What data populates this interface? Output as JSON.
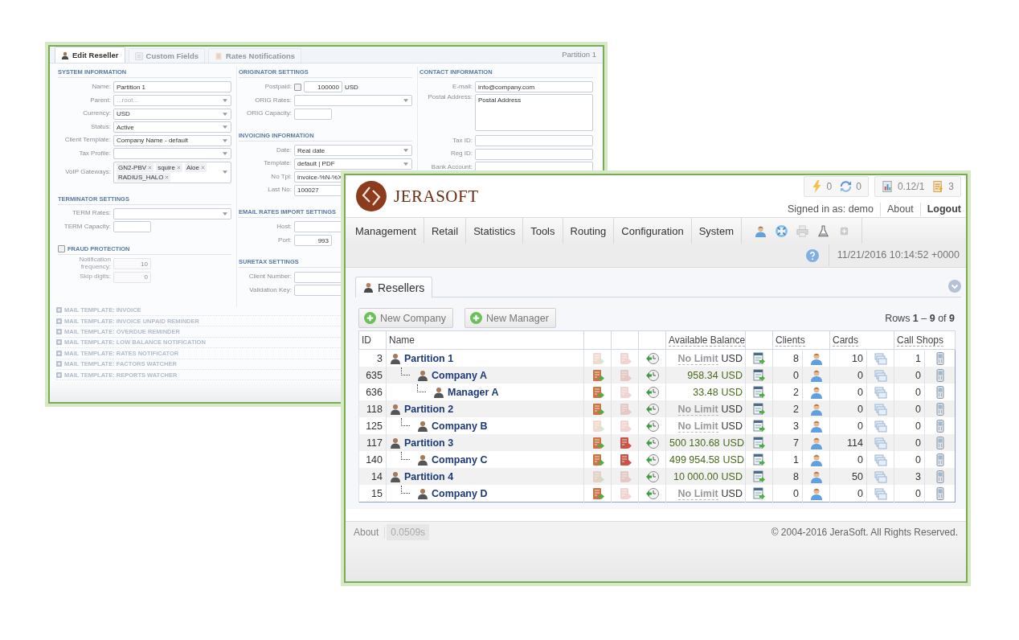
{
  "back_window": {
    "tabs": [
      {
        "label": "Edit Reseller",
        "selected": true
      },
      {
        "label": "Custom Fields",
        "selected": false
      },
      {
        "label": "Rates Notifications",
        "selected": false
      }
    ],
    "heading": "Partition 1",
    "columns": [
      [
        {
          "title": "SYSTEM INFORMATION",
          "kind": "plain",
          "fields": [
            {
              "label": "Name:",
              "kind": "text",
              "value": "Partition 1"
            },
            {
              "label": "Parent:",
              "kind": "select",
              "placeholder": "...root..."
            },
            {
              "label": "Currency:",
              "kind": "select",
              "value": "USD"
            },
            {
              "label": "Status:",
              "kind": "select",
              "value": "Active"
            },
            {
              "label": "Client Template:",
              "kind": "select",
              "value": "Company Name - default"
            },
            {
              "label": "Tax Profile:",
              "kind": "select"
            },
            {
              "label": "VoIP Gateways:",
              "kind": "tags",
              "tags": [
                "GN2-PBV",
                "squire",
                "Aloe",
                "RADIUS_HALO"
              ]
            }
          ]
        },
        {
          "title": "TERMINATOR SETTINGS",
          "kind": "plain",
          "fields": [
            {
              "label": "TERM Rates:",
              "kind": "select"
            },
            {
              "label": "TERM Capacity:",
              "kind": "short"
            }
          ]
        },
        {
          "title": "FRAUD PROTECTION",
          "kind": "toggle",
          "checked": false,
          "fields": [
            {
              "label": "Notification frequency:",
              "kind": "short",
              "value": "10",
              "disabled": true
            },
            {
              "label": "Skip digits:",
              "kind": "short",
              "value": "0",
              "disabled": true
            }
          ]
        }
      ],
      [
        {
          "title": "ORIGINATOR SETTINGS",
          "kind": "plain",
          "fields": [
            {
              "label": "Postpaid:",
              "kind": "amount",
              "checked": false,
              "value": "100000",
              "unit": "USD"
            },
            {
              "label": "ORIG Rates:",
              "kind": "select"
            },
            {
              "label": "ORIG Capacity:",
              "kind": "short"
            }
          ]
        },
        {
          "title": "INVOICING INFORMATION",
          "kind": "plain",
          "fields": [
            {
              "label": "Date:",
              "kind": "select",
              "value": "Real date"
            },
            {
              "label": "Template:",
              "kind": "select",
              "value": "default | PDF"
            },
            {
              "label": "No Tpl:",
              "kind": "text",
              "value": "invoice-%N-%X"
            },
            {
              "label": "Last No:",
              "kind": "text",
              "value": "100027"
            }
          ]
        },
        {
          "title": "EMAIL RATES IMPORT SETTINGS",
          "kind": "plain",
          "fields": [
            {
              "label": "Host:",
              "kind": "text"
            },
            {
              "label": "Port:",
              "kind": "short",
              "value": "993"
            }
          ]
        },
        {
          "title": "SURETAX SETTINGS",
          "kind": "plain",
          "fields": [
            {
              "label": "Client Number:",
              "kind": "text"
            },
            {
              "label": "Validation Key:",
              "kind": "text"
            }
          ]
        }
      ],
      [
        {
          "title": "CONTACT INFORMATION",
          "kind": "plain",
          "fields": [
            {
              "label": "E-mail:",
              "kind": "text",
              "value": "info@company.com"
            },
            {
              "label": "Postal Address:",
              "kind": "textarea",
              "value": "Postal Address"
            },
            {
              "label": "Tax ID:",
              "kind": "text"
            },
            {
              "label": "Reg ID:",
              "kind": "text"
            },
            {
              "label": "Bank Account:",
              "kind": "text"
            }
          ]
        }
      ]
    ],
    "mail_templates": [
      {
        "label": "MAIL TEMPLATE: INVOICE",
        "expanded": false
      },
      {
        "label": "MAIL TEMPLATE: INVOICE UNPAID REMINDER",
        "expanded": false
      },
      {
        "label": "MAIL TEMPLATE: OVERDUE REMINDER",
        "expanded": false
      },
      {
        "label": "MAIL TEMPLATE: LOW BALANCE NOTIFICATION",
        "expanded": false
      },
      {
        "label": "MAIL TEMPLATE: RATES NOTIFICATOR",
        "expanded": false
      },
      {
        "label": "MAIL TEMPLATE: FACTORS WATCHER",
        "expanded": false
      },
      {
        "label": "MAIL TEMPLATE: REPORTS WATCHER",
        "expanded": false
      }
    ]
  },
  "front_window": {
    "logo": "JERASOFT",
    "counter_groups": [
      [
        {
          "kind": "alerts",
          "value": "0"
        },
        {
          "kind": "sync",
          "value": "0"
        }
      ],
      [
        {
          "kind": "load",
          "value": "0.12/1"
        },
        {
          "kind": "tasks",
          "value": "3"
        }
      ]
    ],
    "signed_in": "Signed in as: demo",
    "about": "About",
    "logout": "Logout",
    "menu": [
      "Management",
      "Retail",
      "Statistics",
      "Tools",
      "Routing",
      "Configuration",
      "System"
    ],
    "toolbar_icons": [
      {
        "kind": "user",
        "disabled": false
      },
      {
        "kind": "lifebuoy",
        "disabled": false
      },
      {
        "kind": "printer",
        "disabled": true
      },
      {
        "kind": "flask",
        "disabled": false
      },
      {
        "kind": "add",
        "disabled": true
      }
    ],
    "datetime": "11/21/2016 10:14:52 +0000",
    "tabs": [
      {
        "label": "Resellers",
        "selected": true
      }
    ],
    "buttons": [
      "New Company",
      "New Manager"
    ],
    "rows_info": "Rows **1** – **9** of **9**",
    "table": {
      "columns": [
        "ID",
        "Name",
        "Available Balance",
        "Clients",
        "Cards",
        "Call Shops"
      ],
      "rows": [
        {
          "id": "3",
          "name": "Partition 1",
          "invoices_active": false,
          "charges_active": false,
          "balance": {
            "kind": "unlimited",
            "value": "No Limit"
          },
          "currency": "USD",
          "clients": "8",
          "cards": "10",
          "call_shops": "1",
          "children": [
            {
              "id": "635",
              "name": "Company A",
              "invoices_active": true,
              "charges_active": false,
              "balance": {
                "kind": "amount",
                "value": "958.34"
              },
              "currency": "USD",
              "clients": "0",
              "cards": "0",
              "call_shops": "0",
              "children": [
                {
                  "id": "636",
                  "name": "Manager A",
                  "invoices_active": true,
                  "charges_active": false,
                  "balance": {
                    "kind": "amount",
                    "value": "33.48"
                  },
                  "currency": "USD",
                  "clients": "2",
                  "cards": "0",
                  "call_shops": "0"
                }
              ]
            }
          ]
        },
        {
          "id": "118",
          "name": "Partition 2",
          "invoices_active": true,
          "charges_active": false,
          "balance": {
            "kind": "unlimited",
            "value": "No Limit"
          },
          "currency": "USD",
          "clients": "2",
          "cards": "0",
          "call_shops": "0",
          "children": [
            {
              "id": "125",
              "name": "Company B",
              "invoices_active": false,
              "charges_active": false,
              "balance": {
                "kind": "unlimited",
                "value": "No Limit"
              },
              "currency": "USD",
              "clients": "3",
              "cards": "0",
              "call_shops": "0"
            }
          ]
        },
        {
          "id": "117",
          "name": "Partition 3",
          "invoices_active": true,
          "charges_active": true,
          "balance": {
            "kind": "amount",
            "value": "500 130.68"
          },
          "currency": "USD",
          "clients": "7",
          "cards": "114",
          "call_shops": "0",
          "children": [
            {
              "id": "140",
              "name": "Company C",
              "invoices_active": true,
              "charges_active": true,
              "balance": {
                "kind": "amount",
                "value": "499 954.58"
              },
              "currency": "USD",
              "clients": "1",
              "cards": "0",
              "call_shops": "0"
            }
          ]
        },
        {
          "id": "14",
          "name": "Partition 4",
          "invoices_active": false,
          "charges_active": false,
          "balance": {
            "kind": "amount",
            "value": "10 000.00"
          },
          "currency": "USD",
          "clients": "8",
          "cards": "50",
          "call_shops": "3",
          "children": [
            {
              "id": "15",
              "name": "Company D",
              "invoices_active": true,
              "charges_active": false,
              "balance": {
                "kind": "unlimited",
                "value": "No Limit"
              },
              "currency": "USD",
              "clients": "0",
              "cards": "0",
              "call_shops": "0"
            }
          ]
        }
      ]
    },
    "footer": {
      "about": "About",
      "timing": "0.0509s",
      "copyright": "© 2004-2016 JeraSoft. All Rights Reserved."
    }
  }
}
